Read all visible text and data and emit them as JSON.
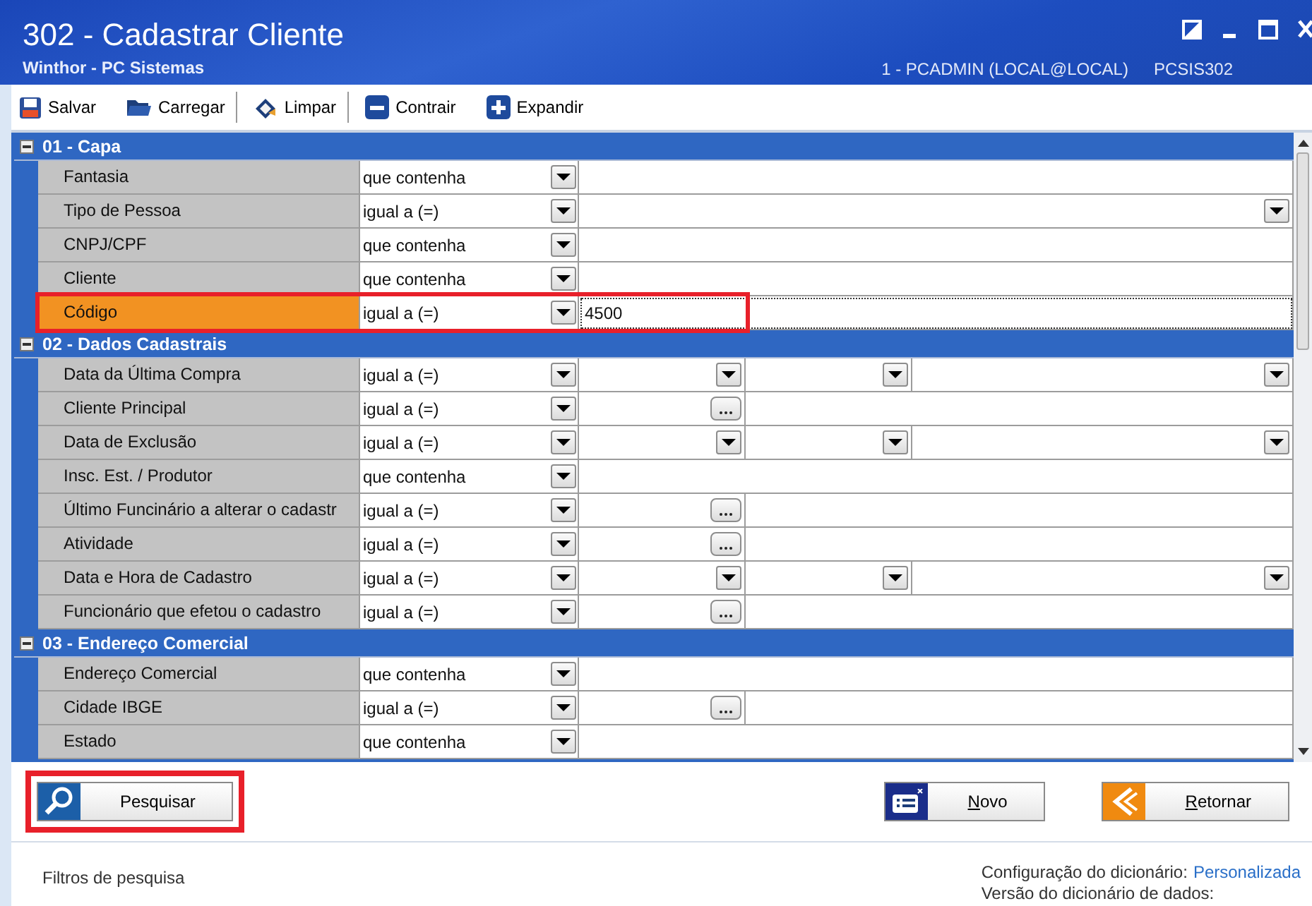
{
  "window": {
    "title": "302 - Cadastrar Cliente",
    "subtitle": "Winthor - PC Sistemas",
    "user": "1 - PCADMIN (LOCAL@LOCAL)",
    "program": "PCSIS302"
  },
  "toolbar": [
    {
      "label": "Salvar"
    },
    {
      "label": "Carregar"
    },
    {
      "label": "Limpar"
    },
    {
      "label": "Contrair"
    },
    {
      "label": "Expandir"
    }
  ],
  "sections": [
    {
      "title": "01 - Capa",
      "expanded": true,
      "rows": [
        {
          "label": "Fantasia",
          "operator": "que contenha",
          "kind": "text",
          "selected": false,
          "highlighted": false
        },
        {
          "label": "Tipo de Pessoa",
          "operator": "igual a (=)",
          "kind": "select",
          "selected": false,
          "highlighted": false
        },
        {
          "label": "CNPJ/CPF",
          "operator": "que contenha",
          "kind": "text",
          "selected": false,
          "highlighted": false
        },
        {
          "label": "Cliente",
          "operator": "que contenha",
          "kind": "text",
          "selected": false,
          "highlighted": false
        },
        {
          "label": "Código",
          "operator": "igual a (=)",
          "kind": "text",
          "value": "4500",
          "selected": true,
          "highlighted": true
        }
      ]
    },
    {
      "title": "02 - Dados Cadastrais",
      "expanded": true,
      "rows": [
        {
          "label": "Data da Última Compra",
          "operator": "igual a (=)",
          "kind": "date_range",
          "selected": false,
          "highlighted": false
        },
        {
          "label": "Cliente Principal",
          "operator": "igual a (=)",
          "kind": "lookup",
          "selected": false,
          "highlighted": false
        },
        {
          "label": "Data de Exclusão",
          "operator": "igual a (=)",
          "kind": "date_range",
          "selected": false,
          "highlighted": false
        },
        {
          "label": "Insc. Est. / Produtor",
          "operator": "que contenha",
          "kind": "text",
          "selected": false,
          "highlighted": false
        },
        {
          "label": "Último Funcinário a alterar o cadastr",
          "operator": "igual a (=)",
          "kind": "lookup",
          "selected": false,
          "highlighted": false
        },
        {
          "label": "Atividade",
          "operator": "igual a (=)",
          "kind": "lookup",
          "selected": false,
          "highlighted": false
        },
        {
          "label": "Data e Hora de Cadastro",
          "operator": "igual a (=)",
          "kind": "date_range",
          "selected": false,
          "highlighted": false
        },
        {
          "label": "Funcionário que efetou o cadastro",
          "operator": "igual a (=)",
          "kind": "lookup",
          "selected": false,
          "highlighted": false
        }
      ]
    },
    {
      "title": "03 - Endereço Comercial",
      "expanded": true,
      "rows": [
        {
          "label": "Endereço Comercial",
          "operator": "que contenha",
          "kind": "text",
          "selected": false,
          "highlighted": false
        },
        {
          "label": "Cidade IBGE",
          "operator": "igual a (=)",
          "kind": "lookup",
          "selected": false,
          "highlighted": false
        },
        {
          "label": "Estado",
          "operator": "que contenha",
          "kind": "text",
          "selected": false,
          "highlighted": false
        }
      ]
    }
  ],
  "buttons": [
    {
      "label": "Pesquisar",
      "kind": "search",
      "mnemonic": false,
      "highlighted": true
    },
    {
      "label": "Novo",
      "kind": "new",
      "mnemonic": true,
      "highlighted": false
    },
    {
      "label": "Retornar",
      "kind": "back",
      "mnemonic": true,
      "highlighted": false
    }
  ],
  "status": {
    "left": "Filtros de pesquisa",
    "config_label": "Configuração do dicionário:",
    "config_value": "Personalizada",
    "version_label": "Versão do dicionário de dados:"
  }
}
